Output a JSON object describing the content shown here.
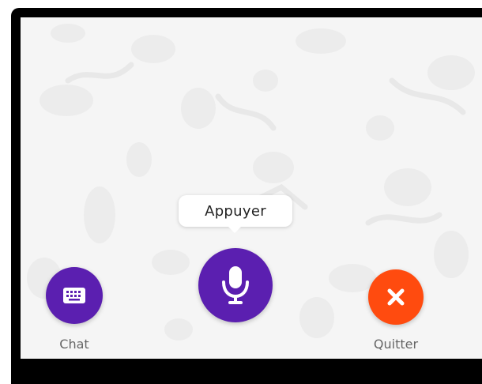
{
  "tooltip": {
    "text": "Appuyer"
  },
  "buttons": {
    "chat": {
      "label": "Chat",
      "icon": "keyboard-icon",
      "color": "#5b1fb0"
    },
    "microphone": {
      "icon": "microphone-icon",
      "color": "#5b1fb0"
    },
    "quit": {
      "label": "Quitter",
      "icon": "close-icon",
      "color": "#ff4b0f"
    }
  },
  "colors": {
    "background": "#f5f5f5",
    "frame": "#000000",
    "doodle": "#ebebeb"
  }
}
